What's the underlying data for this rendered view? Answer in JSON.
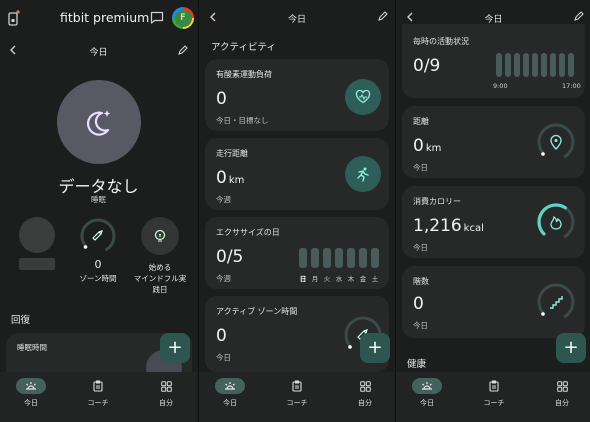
{
  "colors": {
    "bg": "#1c1d1d",
    "card": "#272928",
    "accent": "#5fd4c4",
    "chip": "#2f5e58",
    "sleep_circle": "#5a5a66",
    "sleep_icon": "#e6d7ff"
  },
  "panel1": {
    "app_title": "fitbit premium",
    "avatar_letter": "F",
    "date_title": "今日",
    "sleep_status": "データなし",
    "sleep_label": "睡眠",
    "zone_value": "0",
    "zone_label": "ゾーン時間",
    "mindful_label_1": "始める",
    "mindful_label_2": "マインドフル実",
    "mindful_label_3": "践日",
    "recovery_heading": "回復",
    "sleep_time_title": "睡眠時間"
  },
  "panel2": {
    "date_title": "今日",
    "section_heading": "アクティビティ",
    "aerobic": {
      "title": "有酸素運動負荷",
      "value": "0",
      "sub": "今日・目標なし"
    },
    "distance": {
      "title": "走行距離",
      "value": "0",
      "unit": "km",
      "sub": "今週"
    },
    "exercise_days": {
      "title": "エクササイズの日",
      "value": "0/5",
      "sub": "今週",
      "days": [
        "日",
        "月",
        "火",
        "水",
        "木",
        "金",
        "土"
      ]
    },
    "azm": {
      "title": "アクティブ ゾーン時間",
      "value": "0",
      "sub": "今日"
    }
  },
  "panel3": {
    "date_title": "今日",
    "hourly": {
      "title": "毎時の活動状況",
      "value": "0/9",
      "start_time": "9:00",
      "end_time": "17:00"
    },
    "distance": {
      "title": "距離",
      "value": "0",
      "unit": "km",
      "sub": "今日"
    },
    "calories": {
      "title": "消費カロリー",
      "value": "1,216",
      "unit": "kcal",
      "sub": "今日"
    },
    "floors": {
      "title": "階数",
      "value": "0",
      "sub": "今日"
    },
    "health_heading": "健康"
  },
  "nav": {
    "today": "今日",
    "coach": "コーチ",
    "you": "自分"
  },
  "fab_symbol": "+"
}
